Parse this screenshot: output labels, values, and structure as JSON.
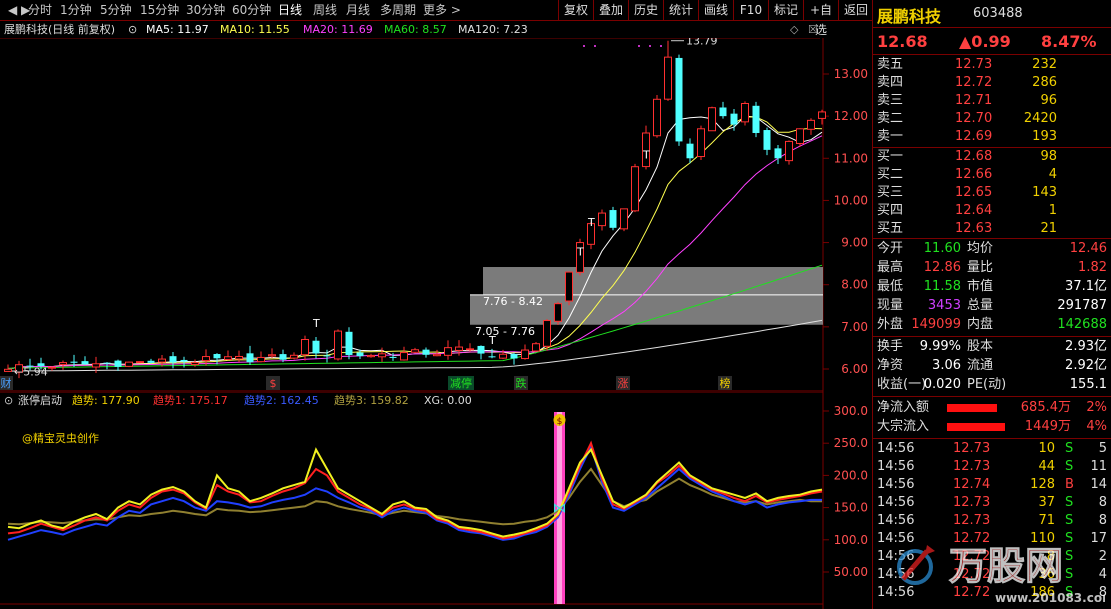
{
  "toolbar": {
    "periods": [
      "分时",
      "1分钟",
      "5分钟",
      "15分钟",
      "30分钟",
      "60分钟",
      "日线",
      "周线",
      "月线",
      "多周期",
      "更多 >"
    ],
    "active": "日线",
    "right": [
      "复权",
      "叠加",
      "历史",
      "统计",
      "画线",
      "F10",
      "标记",
      "+自选",
      "返回"
    ]
  },
  "infobar": {
    "name": "展鹏科技(日线 前复权)",
    "ma5": "MA5: 11.97",
    "ma10": "MA10: 11.55",
    "ma20": "MA20: 11.69",
    "ma60": "MA60: 8.57",
    "ma120": "MA120: 7.23"
  },
  "price_chart": {
    "y_ticks": [
      "13.00",
      "12.00",
      "11.00",
      "10.00",
      "9.00",
      "8.00",
      "7.00",
      "6.00"
    ],
    "high_label": "13.79",
    "low_label": "5.94",
    "box1_label": "7.76 - 8.42",
    "box2_label": "7.05 - 7.76",
    "t_marks": [
      "T",
      "T",
      "T",
      "T",
      "T"
    ],
    "events": [
      {
        "text": "财",
        "color": "#4aa0ff"
      },
      {
        "text": "$",
        "color": "#ff4040"
      },
      {
        "text": "减停",
        "color": "#20e020"
      },
      {
        "text": "跌",
        "color": "#20e020"
      },
      {
        "text": "涨",
        "color": "#ff4040"
      },
      {
        "text": "榜",
        "color": "#f0d000"
      }
    ],
    "colors": {
      "up": "#ff3030",
      "down": "#50ffff",
      "ma5": "#ffffff",
      "ma10": "#ffff50",
      "ma20": "#ff40ff",
      "ma60": "#20e020",
      "ma120": "#e0e0e0"
    }
  },
  "indicator": {
    "name": "涨停启动",
    "t1": "趋势: 177.90",
    "t2": "趋势1: 175.17",
    "t3": "趋势2: 162.45",
    "t4": "趋势3: 159.82",
    "xg": "XG: 0.00",
    "credit": "@精宝灵虫创作",
    "y_ticks": [
      "300.0",
      "250.0",
      "200.0",
      "150.0",
      "100.0",
      "50.00"
    ],
    "signal_icon": "$"
  },
  "chart_data": {
    "type": "line",
    "indicator_values": {
      "trend": [
        120,
        118,
        125,
        130,
        122,
        118,
        128,
        135,
        140,
        132,
        150,
        160,
        155,
        170,
        178,
        182,
        175,
        160,
        150,
        200,
        180,
        175,
        160,
        165,
        172,
        180,
        185,
        190,
        240,
        210,
        180,
        170,
        160,
        150,
        140,
        155,
        160,
        150,
        148,
        135,
        130,
        120,
        118,
        115,
        110,
        105,
        108,
        112,
        118,
        125,
        140,
        180,
        220,
        240,
        200,
        160,
        150,
        160,
        170,
        190,
        205,
        220,
        200,
        190,
        180,
        175,
        170,
        165,
        172,
        160,
        165,
        168,
        170,
        175,
        178
      ],
      "trend1": [
        110,
        112,
        118,
        125,
        120,
        115,
        122,
        130,
        135,
        130,
        145,
        155,
        150,
        165,
        175,
        178,
        172,
        158,
        148,
        185,
        175,
        170,
        158,
        160,
        168,
        175,
        180,
        188,
        210,
        200,
        175,
        165,
        155,
        148,
        138,
        150,
        155,
        148,
        145,
        132,
        128,
        118,
        115,
        112,
        108,
        102,
        105,
        110,
        115,
        122,
        138,
        175,
        215,
        250,
        195,
        155,
        148,
        158,
        168,
        188,
        200,
        215,
        198,
        188,
        178,
        172,
        165,
        160,
        168,
        158,
        162,
        165,
        168,
        172,
        175
      ],
      "trend2": [
        100,
        105,
        110,
        115,
        112,
        108,
        115,
        120,
        125,
        122,
        135,
        145,
        142,
        155,
        160,
        165,
        160,
        150,
        145,
        160,
        158,
        155,
        150,
        152,
        158,
        162,
        165,
        170,
        180,
        175,
        165,
        158,
        150,
        145,
        135,
        145,
        150,
        145,
        142,
        130,
        125,
        115,
        112,
        110,
        105,
        100,
        102,
        108,
        112,
        120,
        135,
        170,
        210,
        245,
        190,
        150,
        145,
        155,
        165,
        180,
        195,
        210,
        195,
        185,
        175,
        168,
        160,
        155,
        160,
        150,
        155,
        158,
        160,
        162,
        162
      ],
      "trend3": [
        125,
        124,
        126,
        128,
        127,
        126,
        128,
        130,
        132,
        131,
        135,
        138,
        137,
        140,
        142,
        145,
        143,
        140,
        138,
        148,
        146,
        145,
        143,
        144,
        146,
        148,
        150,
        152,
        160,
        158,
        152,
        148,
        145,
        142,
        138,
        142,
        145,
        143,
        141,
        137,
        135,
        132,
        130,
        128,
        126,
        124,
        125,
        128,
        130,
        135,
        145,
        165,
        190,
        210,
        185,
        160,
        152,
        158,
        162,
        175,
        185,
        195,
        185,
        178,
        170,
        165,
        160,
        158,
        160,
        155,
        158,
        160,
        162,
        160,
        160
      ]
    }
  },
  "panel": {
    "title": "展鹏科技",
    "code": "603488",
    "price": "12.68",
    "change": "▲0.99",
    "pct": "8.47%",
    "asks": [
      {
        "label": "卖五",
        "price": "12.73",
        "vol": "232"
      },
      {
        "label": "卖四",
        "price": "12.72",
        "vol": "286"
      },
      {
        "label": "卖三",
        "price": "12.71",
        "vol": "96"
      },
      {
        "label": "卖二",
        "price": "12.70",
        "vol": "2420"
      },
      {
        "label": "卖一",
        "price": "12.69",
        "vol": "193"
      }
    ],
    "bids": [
      {
        "label": "买一",
        "price": "12.68",
        "vol": "98"
      },
      {
        "label": "买二",
        "price": "12.66",
        "vol": "4"
      },
      {
        "label": "买三",
        "price": "12.65",
        "vol": "143"
      },
      {
        "label": "买四",
        "price": "12.64",
        "vol": "1"
      },
      {
        "label": "买五",
        "price": "12.63",
        "vol": "21"
      }
    ],
    "stats": [
      {
        "l1": "今开",
        "v1": "11.60",
        "c1": "green",
        "l2": "均价",
        "v2": "12.46",
        "c2": "red"
      },
      {
        "l1": "最高",
        "v1": "12.86",
        "c1": "red",
        "l2": "量比",
        "v2": "1.82",
        "c2": "red"
      },
      {
        "l1": "最低",
        "v1": "11.58",
        "c1": "green",
        "l2": "市值",
        "v2": "37.1亿",
        "c2": "white"
      },
      {
        "l1": "现量",
        "v1": "3453",
        "c1": "purple",
        "l2": "总量",
        "v2": "291787",
        "c2": "white"
      },
      {
        "l1": "外盘",
        "v1": "149099",
        "c1": "red",
        "l2": "内盘",
        "v2": "142688",
        "c2": "green"
      }
    ],
    "stats2": [
      {
        "l1": "换手",
        "v1": "9.99%",
        "l2": "股本",
        "v2": "2.93亿"
      },
      {
        "l1": "净资",
        "v1": "3.06",
        "l2": "流通",
        "v2": "2.92亿"
      },
      {
        "l1": "收益(一)",
        "v1": "0.020",
        "l2": "PE(动)",
        "v2": "155.1"
      }
    ],
    "flow": [
      {
        "label": "净流入额",
        "value": "685.4万",
        "pct": "2%"
      },
      {
        "label": "大宗流入",
        "value": "1449万",
        "pct": "4%"
      }
    ],
    "ticks": [
      {
        "t": "14:56",
        "p": "12.73",
        "v": "10",
        "s": "S",
        "n": "5"
      },
      {
        "t": "14:56",
        "p": "12.73",
        "v": "44",
        "s": "S",
        "n": "11"
      },
      {
        "t": "14:56",
        "p": "12.74",
        "v": "128",
        "s": "B",
        "n": "14"
      },
      {
        "t": "14:56",
        "p": "12.73",
        "v": "37",
        "s": "S",
        "n": "8"
      },
      {
        "t": "14:56",
        "p": "12.73",
        "v": "71",
        "s": "S",
        "n": "8"
      },
      {
        "t": "14:56",
        "p": "12.72",
        "v": "110",
        "s": "S",
        "n": "17"
      },
      {
        "t": "14:56",
        "p": "12.72",
        "v": "8",
        "s": "S",
        "n": "2"
      },
      {
        "t": "14:56",
        "p": "12.72",
        "v": "36",
        "s": "S",
        "n": "4"
      },
      {
        "t": "14:56",
        "p": "12.72",
        "v": "186",
        "s": "S",
        "n": "8"
      }
    ],
    "watermark": "万股网",
    "watermark_url": "www.201083.com"
  }
}
